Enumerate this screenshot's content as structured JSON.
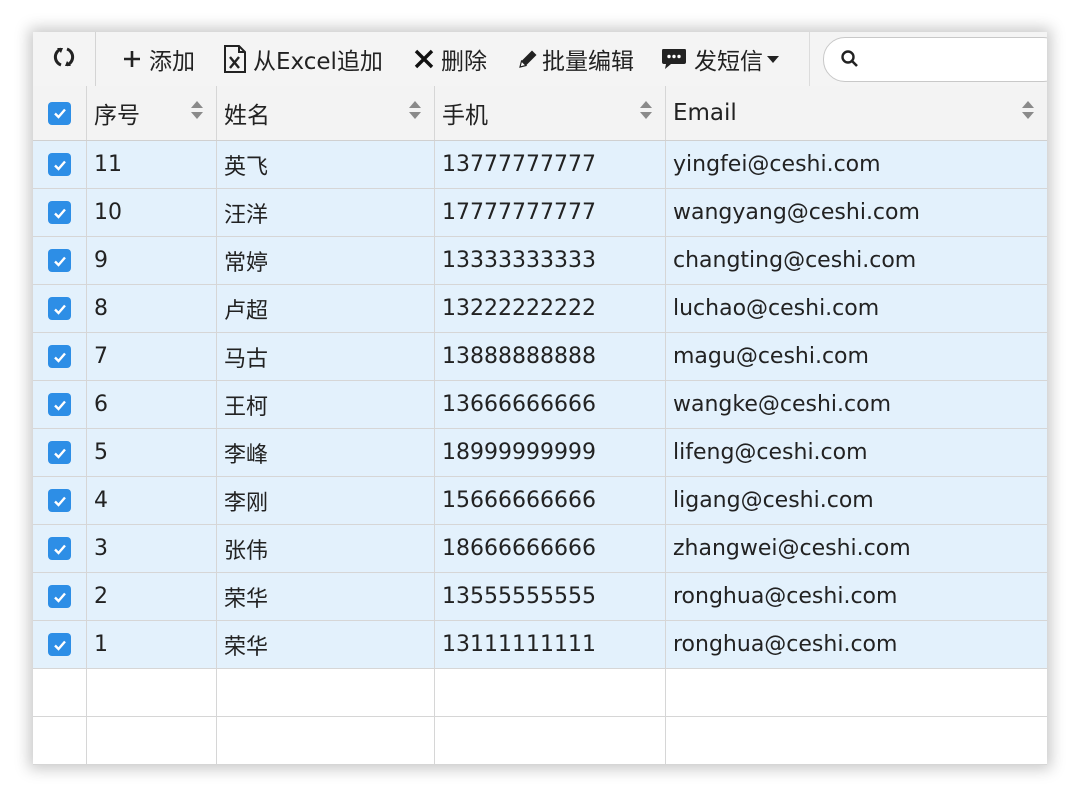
{
  "toolbar": {
    "add_label": "添加",
    "excel_label": "从Excel追加",
    "delete_label": "删除",
    "batch_edit_label": "批量编辑",
    "sms_label": "发短信",
    "search_placeholder": ""
  },
  "table": {
    "columns": [
      "序号",
      "姓名",
      "手机",
      "Email"
    ],
    "rows": [
      {
        "id": "11",
        "name": "英飞",
        "phone": "13777777777",
        "email": "yingfei@ceshi.com"
      },
      {
        "id": "10",
        "name": "汪洋",
        "phone": "17777777777",
        "email": "wangyang@ceshi.com"
      },
      {
        "id": "9",
        "name": "常婷",
        "phone": "13333333333",
        "email": "changting@ceshi.com"
      },
      {
        "id": "8",
        "name": "卢超",
        "phone": "13222222222",
        "email": "luchao@ceshi.com"
      },
      {
        "id": "7",
        "name": "马古",
        "phone": "13888888888",
        "email": "magu@ceshi.com"
      },
      {
        "id": "6",
        "name": "王柯",
        "phone": "13666666666",
        "email": "wangke@ceshi.com"
      },
      {
        "id": "5",
        "name": "李峰",
        "phone": "18999999999",
        "email": "lifeng@ceshi.com"
      },
      {
        "id": "4",
        "name": "李刚",
        "phone": "15666666666",
        "email": "ligang@ceshi.com"
      },
      {
        "id": "3",
        "name": "张伟",
        "phone": "18666666666",
        "email": "zhangwei@ceshi.com"
      },
      {
        "id": "2",
        "name": "荣华",
        "phone": "13555555555",
        "email": "ronghua@ceshi.com"
      },
      {
        "id": "1",
        "name": "荣华",
        "phone": "13111111111",
        "email": "ronghua@ceshi.com"
      }
    ]
  },
  "colors": {
    "accent": "#2d8ee6",
    "selected_row": "#e3f1fc"
  }
}
